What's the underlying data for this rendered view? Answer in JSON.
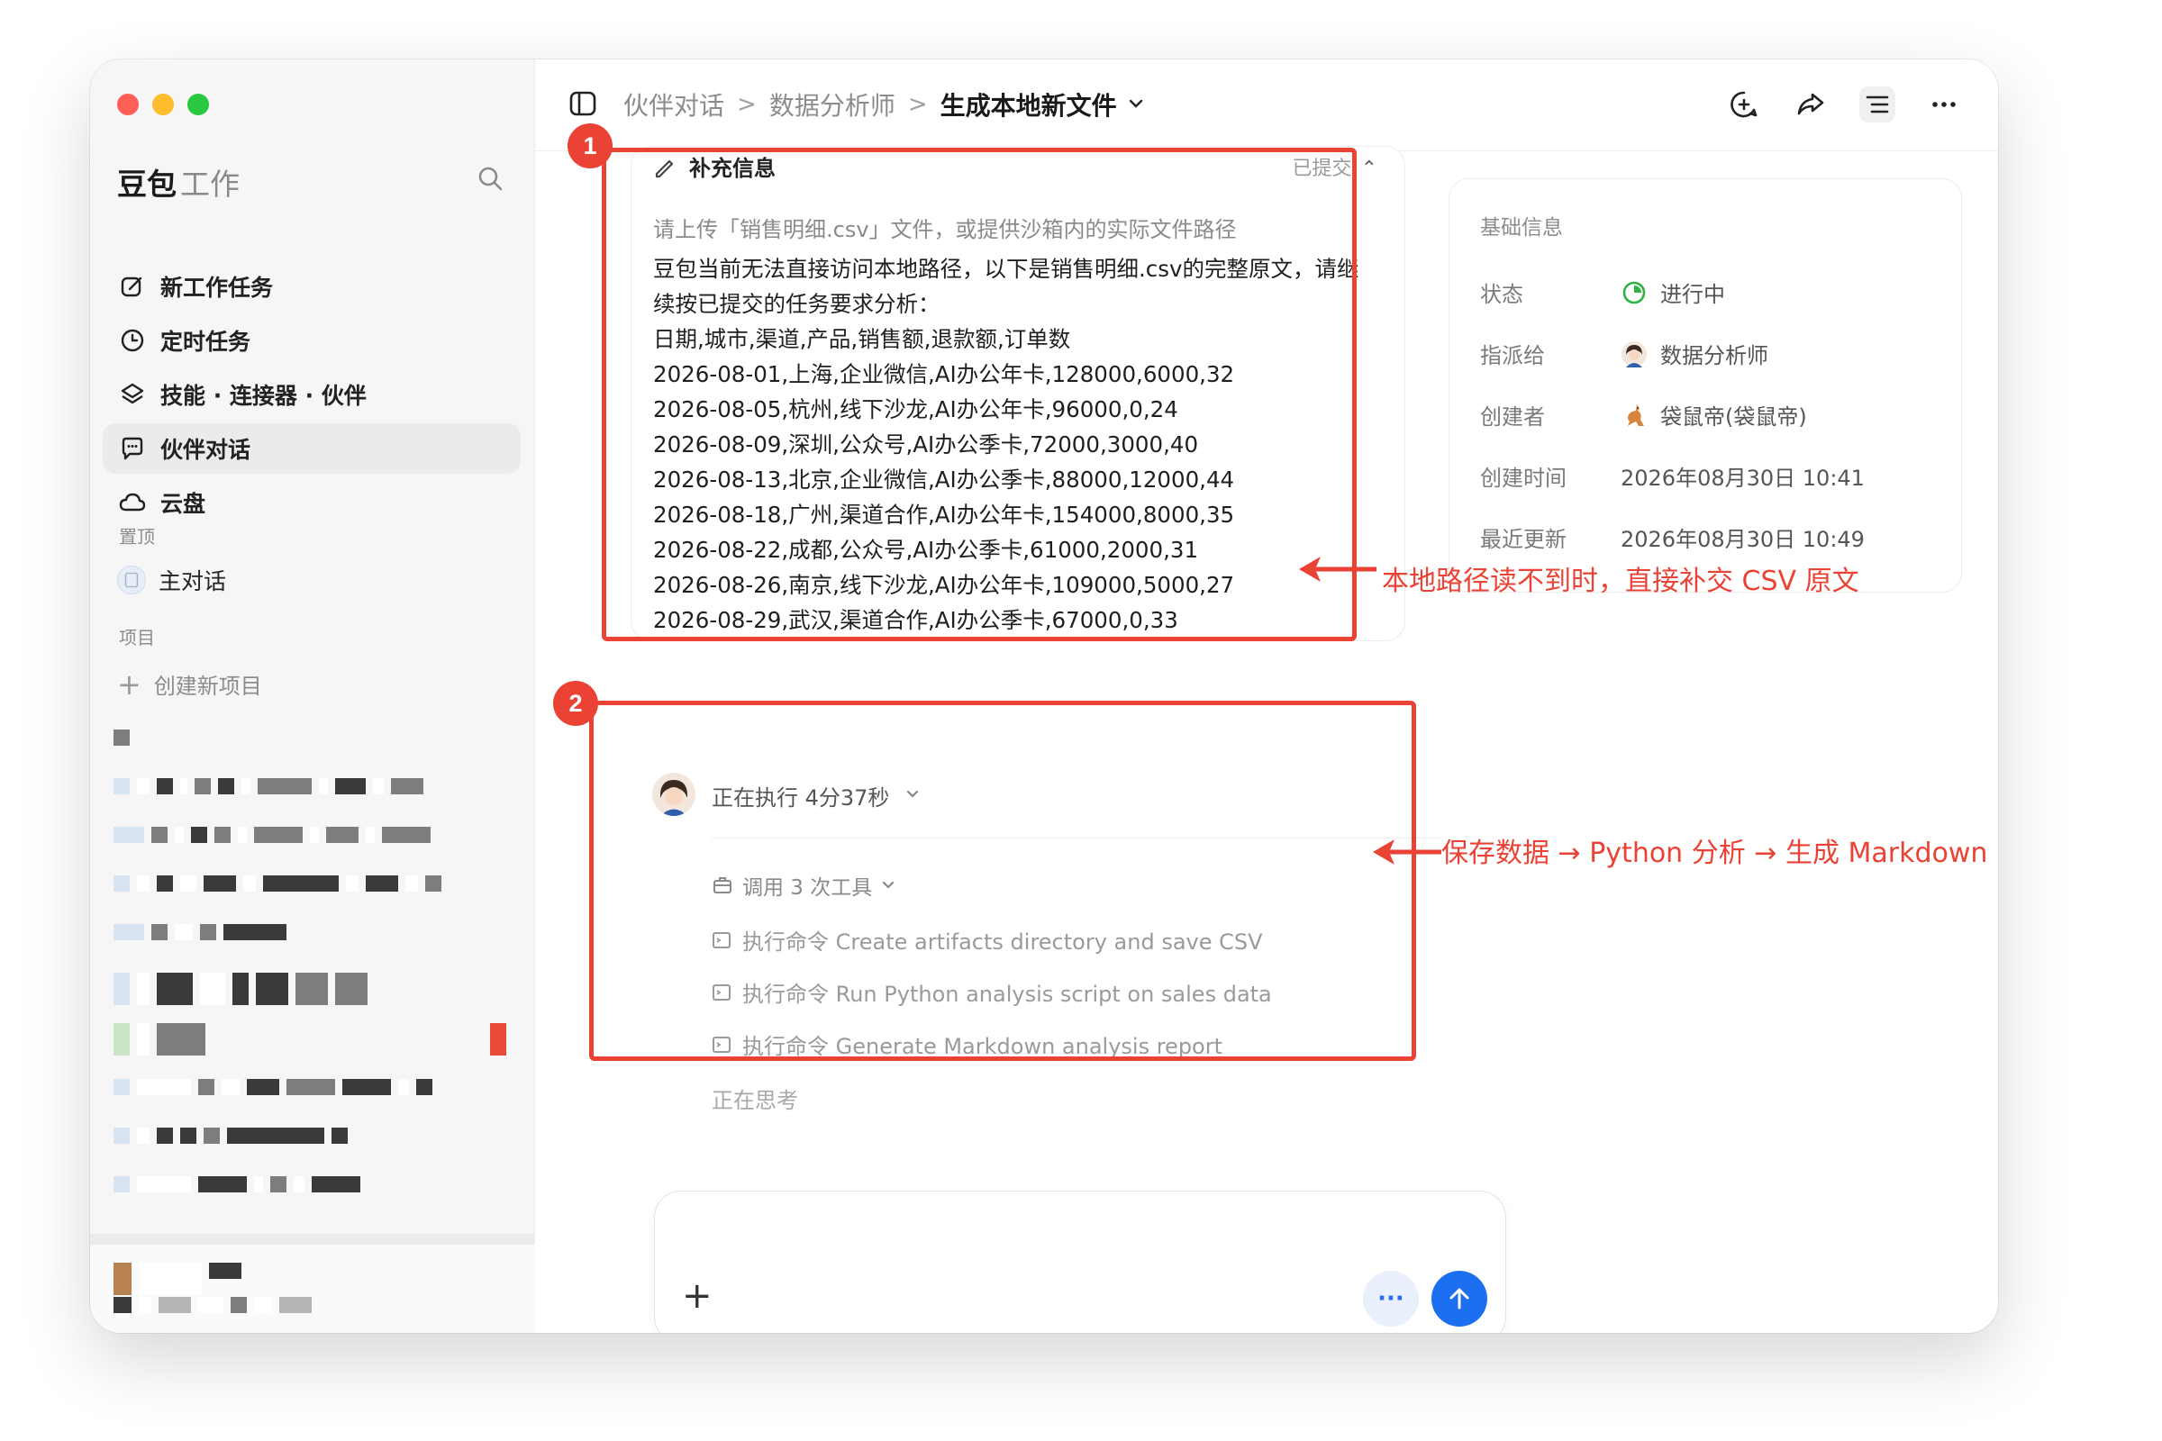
{
  "sidebar": {
    "brand": "豆包",
    "brand_sub": "工作",
    "nav": [
      {
        "label": "新工作任务",
        "icon": "edit-icon"
      },
      {
        "label": "定时任务",
        "icon": "clock-icon"
      },
      {
        "label": "技能 · 连接器 · 伙伴",
        "icon": "layers-icon"
      },
      {
        "label": "伙伴对话",
        "icon": "chat-icon"
      },
      {
        "label": "云盘",
        "icon": "cloud-icon"
      }
    ],
    "pinned_label": "置顶",
    "pinned_item": "主对话",
    "projects_label": "项目",
    "new_project": "创建新项目"
  },
  "header": {
    "crumbs": [
      "伙伴对话",
      "数据分析师"
    ],
    "current": "生成本地新文件"
  },
  "supplement": {
    "title": "补充信息",
    "status": "已提交",
    "prompt": "请上传「销售明细.csv」文件，或提供沙箱内的实际文件路径",
    "intro": "豆包当前无法直接访问本地路径，以下是销售明细.csv的完整原文，请继续按已提交的任务要求分析：",
    "csv_lines": [
      "日期,城市,渠道,产品,销售额,退款额,订单数",
      "2026-08-01,上海,企业微信,AI办公年卡,128000,6000,32",
      "2026-08-05,杭州,线下沙龙,AI办公年卡,96000,0,24",
      "2026-08-09,深圳,公众号,AI办公季卡,72000,3000,40",
      "2026-08-13,北京,企业微信,AI办公季卡,88000,12000,44",
      "2026-08-18,广州,渠道合作,AI办公年卡,154000,8000,35",
      "2026-08-22,成都,公众号,AI办公季卡,61000,2000,31",
      "2026-08-26,南京,线下沙龙,AI办公年卡,109000,5000,27",
      "2026-08-29,武汉,渠道合作,AI办公季卡,67000,0,33"
    ]
  },
  "info": {
    "title": "基础信息",
    "rows": [
      {
        "key": "状态",
        "value": "进行中"
      },
      {
        "key": "指派给",
        "value": "数据分析师"
      },
      {
        "key": "创建者",
        "value": "袋鼠帝(袋鼠帝)"
      },
      {
        "key": "创建时间",
        "value": "2026年08月30日 10:41"
      },
      {
        "key": "最近更新",
        "value": "2026年08月30日 10:49"
      }
    ]
  },
  "execution": {
    "title": "正在执行 4分37秒",
    "tools_label": "调用 3 次工具",
    "commands": [
      "执行命令 Create artifacts directory and save CSV",
      "执行命令 Run Python analysis script on sales data",
      "执行命令 Generate Markdown analysis report"
    ],
    "thinking": "正在思考"
  },
  "annotations": {
    "badge1": "1",
    "badge2": "2",
    "note1": "本地路径读不到时，直接补交 CSV 原文",
    "note2": "保存数据 → Python 分析 → 生成 Markdown"
  },
  "composer": {
    "more_label": "···"
  },
  "colors": {
    "accent": "#1d6ff2",
    "annotation": "#ea4335",
    "status_green": "#2fb344"
  }
}
